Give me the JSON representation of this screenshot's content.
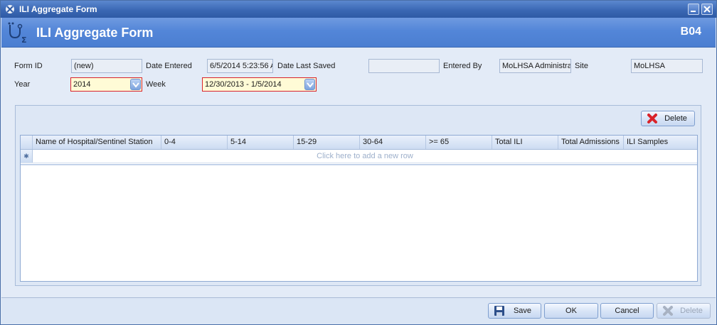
{
  "window": {
    "title": "ILI Aggregate Form"
  },
  "header": {
    "title": "ILI Aggregate Form",
    "code": "B04"
  },
  "form": {
    "form_id_label": "Form ID",
    "form_id_value": "(new)",
    "date_entered_label": "Date Entered",
    "date_entered_value": "6/5/2014 5:23:56 A",
    "date_last_saved_label": "Date Last Saved",
    "date_last_saved_value": "",
    "entered_by_label": "Entered By",
    "entered_by_value": "MoLHSA Administra",
    "site_label": "Site",
    "site_value": "MoLHSA",
    "year_label": "Year",
    "year_value": "2014",
    "week_label": "Week",
    "week_value": "12/30/2013 - 1/5/2014"
  },
  "grid": {
    "delete_label": "Delete",
    "columns": [
      "Name of Hospital/Sentinel Station",
      "0-4",
      "5-14",
      "15-29",
      "30-64",
      ">= 65",
      "Total ILI",
      "Total Admissions",
      "ILI Samples"
    ],
    "new_row_hint": "Click here to add a new row",
    "new_row_marker": "✱"
  },
  "footer": {
    "save_label": "Save",
    "ok_label": "OK",
    "cancel_label": "Cancel",
    "delete_label": "Delete"
  },
  "colors": {
    "header_blue": "#4b7ed1",
    "required_border": "#d9232a",
    "required_fill": "#fffbd6",
    "delete_red": "#d9232a"
  }
}
